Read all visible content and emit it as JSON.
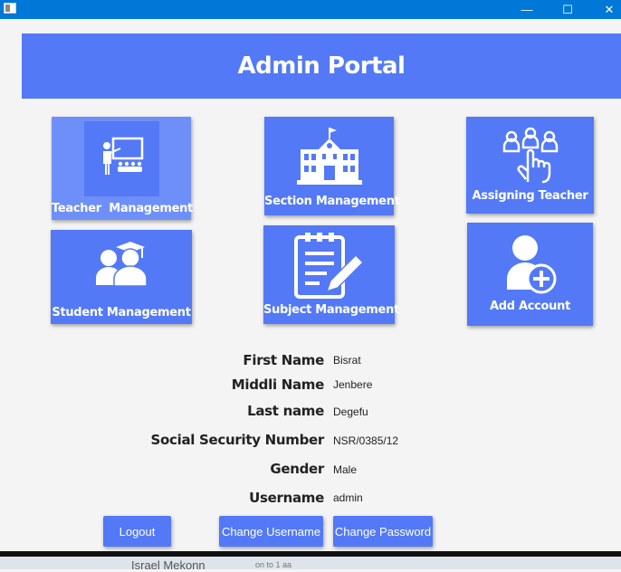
{
  "window": {
    "minimize_glyph": "—",
    "maximize_glyph": "☐",
    "close_glyph": "✕"
  },
  "header": {
    "title": "Admin Portal"
  },
  "tiles": [
    {
      "label": "Teacher  Management",
      "icon": "teacher-icon"
    },
    {
      "label": "Section Management",
      "icon": "school-building-icon"
    },
    {
      "label": "Assigning Teacher",
      "icon": "group-select-icon"
    },
    {
      "label": "Student Management",
      "icon": "students-icon"
    },
    {
      "label": "Subject Management",
      "icon": "clipboard-edit-icon"
    },
    {
      "label": "Add Account",
      "icon": "add-user-icon"
    }
  ],
  "profile": {
    "first_name_label": "First Name",
    "first_name": "Bisrat",
    "middle_name_label": "Middli Name",
    "middle_name": "Jenbere",
    "last_name_label": "Last name",
    "last_name": "Degefu",
    "ssn_label": "Social Security Number",
    "ssn": "NSR/0385/12",
    "gender_label": "Gender",
    "gender": "Male",
    "username_label": "Username",
    "username": "admin"
  },
  "buttons": {
    "logout": "Logout",
    "change_username": "Change Username",
    "change_password": "Change Password"
  },
  "taskbar": {
    "text": "Israel Mekonn",
    "text2": "on to 1 aa"
  },
  "colors": {
    "accent": "#5379f6",
    "accent_light": "#6f8ff8",
    "titlebar": "#0078d7",
    "background": "#f4f4f4"
  }
}
